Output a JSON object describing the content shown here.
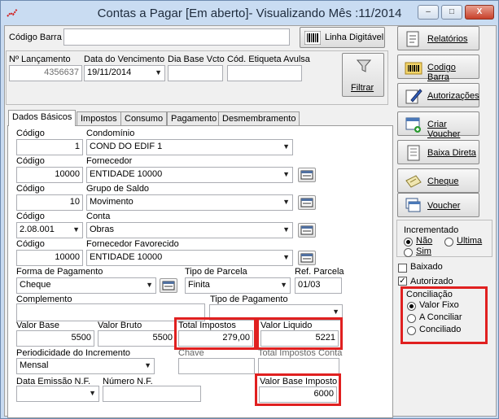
{
  "window": {
    "title": "Contas a Pagar [Em aberto]- Visualizando Mês :11/2014",
    "minimize": "–",
    "maximize": "□",
    "close": "X"
  },
  "header": {
    "codigo_barra_label": "Código Barra",
    "codigo_barra_value": "",
    "linha_digitavel_button": "Linha Digitável",
    "lancamento_label": "Nº Lançamento",
    "lancamento_value": "4356637",
    "vencimento_label": "Data do Vencimento",
    "vencimento_value": "19/11/2014",
    "dia_base_label": "Dia Base Vcto",
    "dia_base_value": "",
    "etiqueta_label": "Cód. Etiqueta Avulsa",
    "etiqueta_value": "",
    "filtrar_button": "Filtrar"
  },
  "tabs": [
    "Dados Básicos",
    "Impostos",
    "Consumo",
    "Pagamento",
    "Desmembramento"
  ],
  "form": {
    "codigo_label": "Código",
    "condominio_label": "Condomínio",
    "condominio_codigo": "1",
    "condominio_value": "COND DO EDIF 1",
    "fornecedor_label": "Fornecedor",
    "fornecedor_codigo": "10000",
    "fornecedor_value": "ENTIDADE 10000",
    "grupo_label": "Grupo de Saldo",
    "grupo_codigo": "10",
    "grupo_value": "Movimento",
    "conta_label": "Conta",
    "conta_codigo": "2.08.001",
    "conta_value": "Obras",
    "favorecido_label": "Fornecedor Favorecido",
    "favorecido_codigo": "10000",
    "favorecido_value": "ENTIDADE 10000",
    "forma_pagamento_label": "Forma de Pagamento",
    "forma_pagamento_value": "Cheque",
    "tipo_parcela_label": "Tipo de Parcela",
    "tipo_parcela_value": "Finita",
    "ref_parcela_label": "Ref. Parcela",
    "ref_parcela_value": "01/03",
    "complemento_label": "Complemento",
    "complemento_value": "",
    "tipo_pagamento_label": "Tipo de Pagamento",
    "tipo_pagamento_value": "",
    "valor_base_label": "Valor Base",
    "valor_base_value": "5500",
    "valor_bruto_label": "Valor Bruto",
    "valor_bruto_value": "5500",
    "total_impostos_label": "Total Impostos",
    "total_impostos_value": "279,00",
    "valor_liquido_label": "Valor Liquido",
    "valor_liquido_value": "5221",
    "periodicidade_label": "Periodicidade do Incremento",
    "periodicidade_value": "Mensal",
    "chave_label": "Chave",
    "chave_value": "",
    "total_impostos_conta_label": "Total Impostos Conta",
    "total_impostos_conta_value": "",
    "data_emissao_label": "Data Emissão N.F.",
    "data_emissao_value": "",
    "numero_nf_label": "Número N.F.",
    "numero_nf_value": "",
    "valor_base_imposto_label": "Valor Base Imposto",
    "valor_base_imposto_value": "6000"
  },
  "sidebar": {
    "buttons": [
      "Relatórios",
      "Codigo Barra",
      "Autorizações",
      "Criar Voucher",
      "Baixa Direta",
      "Cheque",
      "Voucher"
    ],
    "incrementado_label": "Incrementado",
    "incrementado_options": [
      "Não",
      "Ultima",
      "Sim"
    ],
    "baixado_label": "Baixado",
    "autorizado_label": "Autorizado",
    "conciliacao_label": "Conciliação",
    "conciliacao_options": [
      "Valor Fixo",
      "A Conciliar",
      "Conciliado"
    ]
  },
  "colors": {
    "highlight": "#e02020",
    "title_bg": "#c9dcf2"
  }
}
